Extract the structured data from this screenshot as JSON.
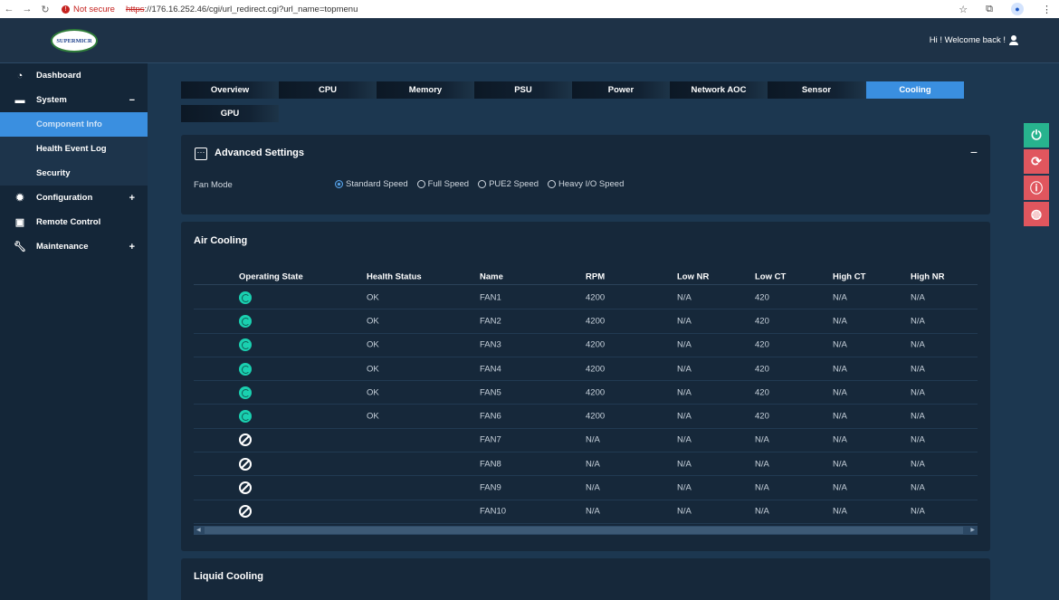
{
  "browser": {
    "not_secure": "Not secure",
    "url_proto": "https",
    "url_rest": "://176.16.252.46/cgi/url_redirect.cgi?url_name=topmenu"
  },
  "header": {
    "logo_text": "SUPERMICR",
    "welcome": "Hi ! Welcome back !"
  },
  "sidebar": {
    "dashboard": "Dashboard",
    "system": "System",
    "system_toggle": "−",
    "component_info": "Component Info",
    "health_event_log": "Health Event Log",
    "security": "Security",
    "configuration": "Configuration",
    "configuration_toggle": "+",
    "remote_control": "Remote Control",
    "maintenance": "Maintenance",
    "maintenance_toggle": "+"
  },
  "tabs": {
    "overview": "Overview",
    "cpu": "CPU",
    "memory": "Memory",
    "psu": "PSU",
    "power": "Power",
    "network_aoc": "Network AOC",
    "sensor": "Sensor",
    "cooling": "Cooling",
    "gpu": "GPU"
  },
  "advanced": {
    "title": "Advanced Settings",
    "dots": "···",
    "collapse": "−",
    "fan_mode_label": "Fan Mode",
    "options": {
      "standard": "Standard Speed",
      "full": "Full Speed",
      "pue2": "PUE2 Speed",
      "heavy_io": "Heavy I/O Speed"
    },
    "selected": "Standard Speed"
  },
  "air_cooling": {
    "title": "Air Cooling",
    "columns": {
      "operating_state": "Operating State",
      "health_status": "Health Status",
      "name": "Name",
      "rpm": "RPM",
      "low_nr": "Low NR",
      "low_ct": "Low CT",
      "high_ct": "High CT",
      "high_nr": "High NR"
    },
    "rows": [
      {
        "state": "on",
        "health": "OK",
        "name": "FAN1",
        "rpm": "4200",
        "low_nr": "N/A",
        "low_ct": "420",
        "high_ct": "N/A",
        "high_nr": "N/A"
      },
      {
        "state": "on",
        "health": "OK",
        "name": "FAN2",
        "rpm": "4200",
        "low_nr": "N/A",
        "low_ct": "420",
        "high_ct": "N/A",
        "high_nr": "N/A"
      },
      {
        "state": "on",
        "health": "OK",
        "name": "FAN3",
        "rpm": "4200",
        "low_nr": "N/A",
        "low_ct": "420",
        "high_ct": "N/A",
        "high_nr": "N/A"
      },
      {
        "state": "on",
        "health": "OK",
        "name": "FAN4",
        "rpm": "4200",
        "low_nr": "N/A",
        "low_ct": "420",
        "high_ct": "N/A",
        "high_nr": "N/A"
      },
      {
        "state": "on",
        "health": "OK",
        "name": "FAN5",
        "rpm": "4200",
        "low_nr": "N/A",
        "low_ct": "420",
        "high_ct": "N/A",
        "high_nr": "N/A"
      },
      {
        "state": "on",
        "health": "OK",
        "name": "FAN6",
        "rpm": "4200",
        "low_nr": "N/A",
        "low_ct": "420",
        "high_ct": "N/A",
        "high_nr": "N/A"
      },
      {
        "state": "off",
        "health": "",
        "name": "FAN7",
        "rpm": "N/A",
        "low_nr": "N/A",
        "low_ct": "N/A",
        "high_ct": "N/A",
        "high_nr": "N/A"
      },
      {
        "state": "off",
        "health": "",
        "name": "FAN8",
        "rpm": "N/A",
        "low_nr": "N/A",
        "low_ct": "N/A",
        "high_ct": "N/A",
        "high_nr": "N/A"
      },
      {
        "state": "off",
        "health": "",
        "name": "FAN9",
        "rpm": "N/A",
        "low_nr": "N/A",
        "low_ct": "N/A",
        "high_ct": "N/A",
        "high_nr": "N/A"
      },
      {
        "state": "off",
        "health": "",
        "name": "FAN10",
        "rpm": "N/A",
        "low_nr": "N/A",
        "low_ct": "N/A",
        "high_ct": "N/A",
        "high_nr": "N/A"
      }
    ]
  },
  "liquid_cooling": {
    "title": "Liquid Cooling"
  },
  "actions": [
    {
      "icon": "power-icon",
      "glyph": "⏻",
      "color": "#27b38e"
    },
    {
      "icon": "refresh-icon",
      "glyph": "⟳",
      "color": "#e0565e"
    },
    {
      "icon": "info-icon",
      "glyph": "ⓘ",
      "color": "#e0565e"
    },
    {
      "icon": "globe-icon",
      "glyph": "◍",
      "color": "#e0565e"
    }
  ]
}
